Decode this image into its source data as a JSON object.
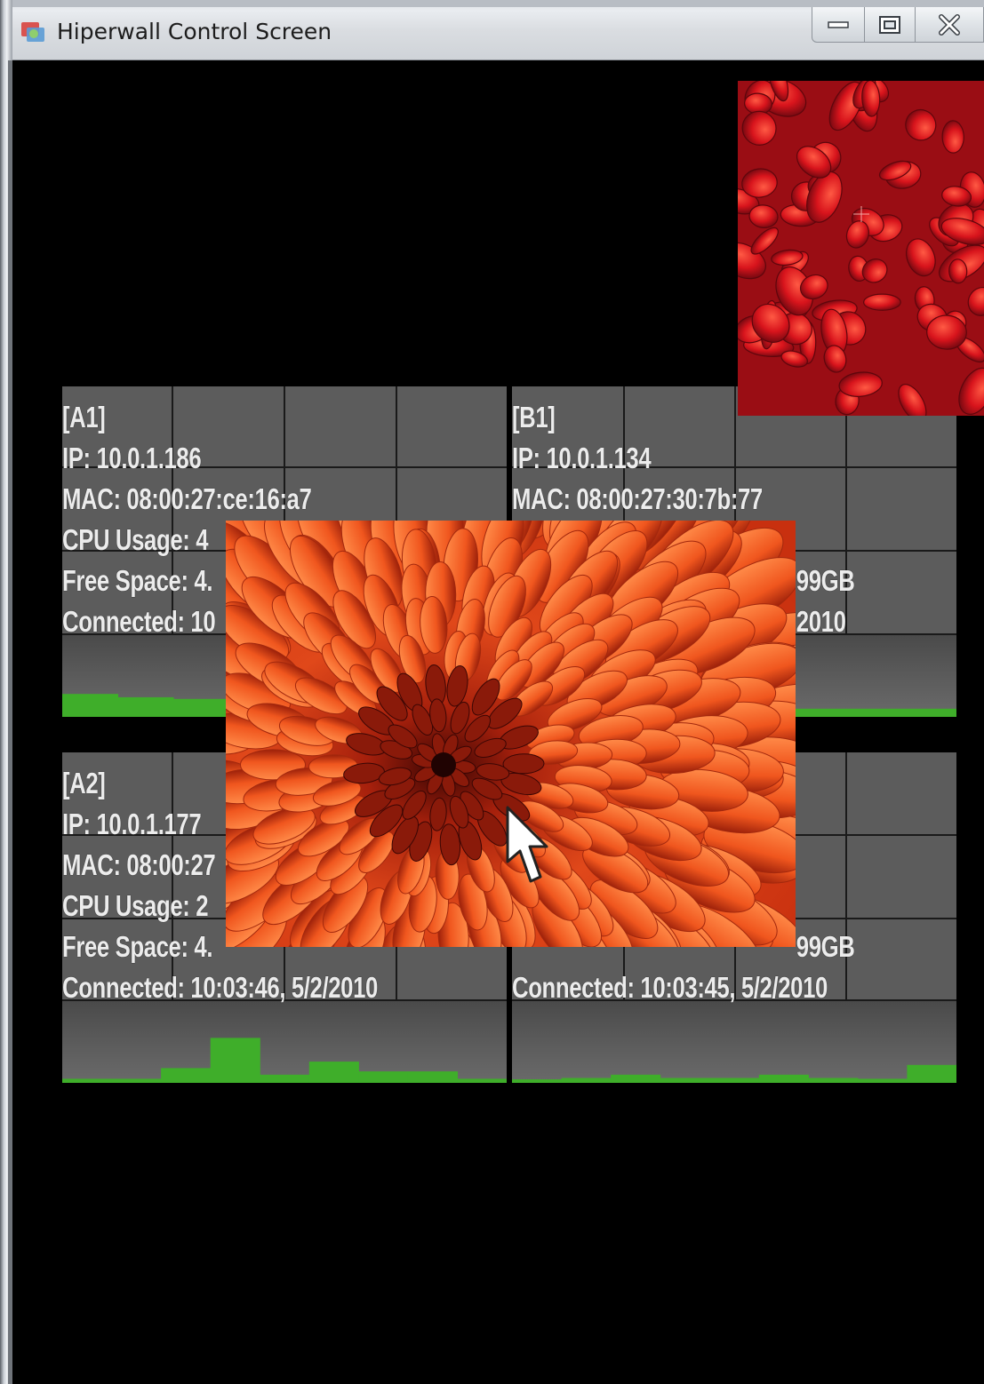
{
  "window": {
    "title": "Hiperwall Control Screen",
    "controls": {
      "minimize": "minimize",
      "maximize": "maximize",
      "close": "close"
    }
  },
  "tiles": [
    {
      "id": "A1",
      "lines": [
        "[A1]",
        "IP: 10.0.1.186",
        "MAC: 08:00:27:ce:16:a7",
        "CPU Usage: 4",
        "Free Space: 4.",
        "Connected: 10"
      ],
      "cpu_history": [
        0.28,
        0.24,
        0.22,
        0.22,
        0.06,
        0.06,
        0.24,
        0.24
      ]
    },
    {
      "id": "B1",
      "lines": [
        "[B1]",
        "IP: 10.0.1.134",
        "MAC: 08:00:27:30:7b:77",
        "",
        "99GB",
        "2010"
      ],
      "cpu_history": [
        0.22,
        0.06,
        0.1,
        0.1
      ]
    },
    {
      "id": "A2",
      "lines": [
        "[A2]",
        "IP: 10.0.1.177",
        "MAC: 08:00:27",
        "CPU Usage: 2",
        "Free Space: 4.",
        "Connected: 10:03:46, 5/2/2010"
      ],
      "cpu_history": [
        0.05,
        0.05,
        0.18,
        0.55,
        0.1,
        0.26,
        0.14,
        0.14,
        0.05
      ]
    },
    {
      "id": "B2",
      "lines": [
        "",
        "",
        "",
        "",
        "99GB",
        "Connected: 10:03:45, 5/2/2010"
      ],
      "cpu_history": [
        0.03,
        0.06,
        0.1,
        0.06,
        0.06,
        0.1,
        0.06,
        0.05,
        0.22
      ]
    }
  ],
  "images": [
    {
      "name": "red-petals",
      "colors": {
        "base": "#c8141e",
        "light": "#f03a2c",
        "dark": "#7a0a12"
      }
    },
    {
      "name": "orange-chrysanthemum",
      "colors": {
        "base": "#e2471a",
        "light": "#ff7a3a",
        "dark": "#7e1208"
      }
    }
  ],
  "colors": {
    "tile_bg": "#5c5c5c",
    "grid": "#1a1a1a",
    "bar": "#3fae2a",
    "text": "#ececec"
  }
}
